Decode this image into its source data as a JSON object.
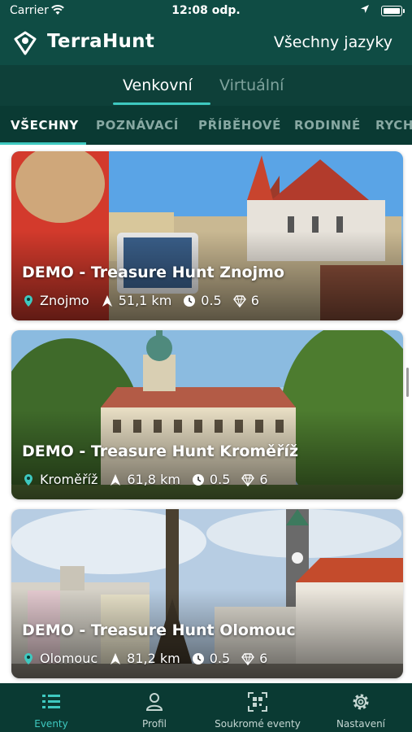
{
  "status_bar": {
    "carrier": "Carrier",
    "time": "12:08 odp."
  },
  "header": {
    "app_name": "TerraHunt",
    "language_button": "Všechny jazyky",
    "logo_icon": "shield-pin-icon"
  },
  "mode_tabs": [
    {
      "label": "Venkovní",
      "active": true
    },
    {
      "label": "Virtuální",
      "active": false
    }
  ],
  "category_tabs": [
    {
      "label": "VŠECHNY",
      "active": true
    },
    {
      "label": "POZNÁVACÍ",
      "active": false
    },
    {
      "label": "PŘÍBĚHOVÉ",
      "active": false
    },
    {
      "label": "RODINNÉ",
      "active": false
    },
    {
      "label": "RYCH",
      "active": false
    }
  ],
  "events": [
    {
      "title": "DEMO - Treasure Hunt Znojmo",
      "location": "Znojmo",
      "distance": "51,1 km",
      "duration": "0.5",
      "gems": "6"
    },
    {
      "title": "DEMO - Treasure Hunt Kroměříž",
      "location": "Kroměříž",
      "distance": "61,8 km",
      "duration": "0.5",
      "gems": "6"
    },
    {
      "title": "DEMO - Treasure Hunt Olomouc",
      "location": "Olomouc",
      "distance": "81,2 km",
      "duration": "0.5",
      "gems": "6"
    }
  ],
  "bottom_nav": [
    {
      "label": "Eventy",
      "icon": "list-icon",
      "active": true
    },
    {
      "label": "Profil",
      "icon": "profile-icon",
      "active": false
    },
    {
      "label": "Soukromé eventy",
      "icon": "qr-scan-icon",
      "active": false
    },
    {
      "label": "Nastavení",
      "icon": "gear-icon",
      "active": false
    }
  ],
  "colors": {
    "primary": "#0f4c44",
    "dark": "#0a3a33",
    "accent": "#3ec9c0"
  }
}
